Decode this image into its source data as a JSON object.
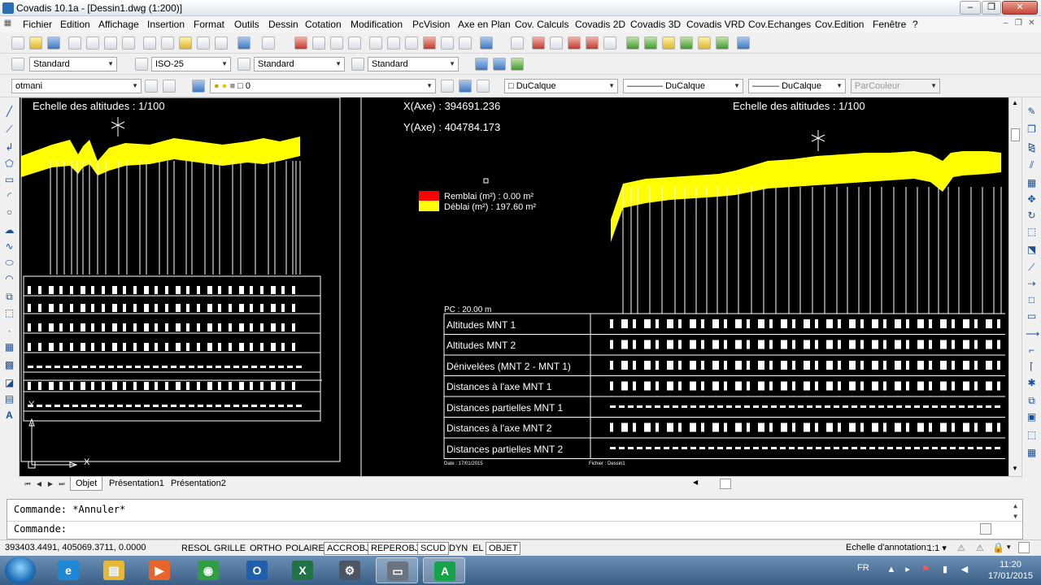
{
  "window": {
    "title": "Covadis 10.1a - [Dessin1.dwg (1:200)]",
    "minimize": "‒",
    "restore": "❐",
    "close": "✕"
  },
  "menu": {
    "items": [
      "Fichier",
      "Edition",
      "Affichage",
      "Insertion",
      "Format",
      "Outils",
      "Dessin",
      "Cotation",
      "Modification",
      "PcVision",
      "Axe en Plan",
      "Cov. Calculs",
      "Covadis 2D",
      "Covadis 3D",
      "Covadis VRD",
      "Cov.Echanges",
      "Cov.Edition",
      "Fenêtre",
      "?"
    ]
  },
  "toolbar_styles": {
    "text_style": "Standard",
    "dim_style": "ISO-25",
    "table_style": "Standard",
    "multileader_style": "Standard"
  },
  "toolbar_layers": {
    "current_layer": "otmani",
    "layer_state": "0",
    "color": "DuCalque",
    "linetype": "DuCalque",
    "lineweight": "DuCalque",
    "plot_style": "ParCouleur"
  },
  "drawing": {
    "left_scale_label": "Echelle des altitudes : 1/100",
    "right_scale_label": "Echelle des altitudes : 1/100",
    "x_axe": "X(Axe) : 394691.236",
    "y_axe": "Y(Axe) : 404784.173",
    "legend": {
      "remblai": "Remblai (m²) : 0.00 m²",
      "deblai": "Déblai (m²) : 197.60 m²",
      "remblai_color": "#ff0000",
      "deblai_color": "#ffff00"
    },
    "pc_label": "PC : 20.00 m",
    "rows": [
      "Altitudes MNT 1",
      "Altitudes MNT 2",
      "Dénivelées (MNT 2 - MNT 1)",
      "Distances à l'axe MNT 1",
      "Distances partielles MNT 1",
      "Distances à l'axe MNT 2",
      "Distances partielles MNT 2"
    ],
    "footer_date": "Date : 17/01/2015",
    "footer_file": "Fichier : Dessin1",
    "ucs_x": "X",
    "ucs_y": "Y",
    "profile_color": "#ffff00"
  },
  "tabs": {
    "items": [
      "Objet",
      "Présentation1",
      "Présentation2"
    ],
    "active": "Objet"
  },
  "command": {
    "history": "Commande: *Annuler*",
    "prompt": "Commande:"
  },
  "status": {
    "coordinates": "393403.4491, 405069.3711, 0.0000",
    "toggles": [
      {
        "label": "RESOL",
        "on": false
      },
      {
        "label": "GRILLE",
        "on": false
      },
      {
        "label": "ORTHO",
        "on": false
      },
      {
        "label": "POLAIRE",
        "on": false
      },
      {
        "label": "ACCROBJ",
        "on": true
      },
      {
        "label": "REPEROBJ",
        "on": true
      },
      {
        "label": "SCUD",
        "on": true
      },
      {
        "label": "DYN",
        "on": false
      },
      {
        "label": "EL",
        "on": false
      },
      {
        "label": "OBJET",
        "on": true
      }
    ],
    "annotation_scale_label": "Echelle d'annotation:",
    "annotation_scale_value": "1:1"
  },
  "taskbar": {
    "apps": [
      {
        "name": "internet-explorer",
        "glyph": "e",
        "color": "#1e88d6"
      },
      {
        "name": "file-explorer",
        "glyph": "▤",
        "color": "#e7b93a"
      },
      {
        "name": "media-player",
        "glyph": "▶",
        "color": "#e8642a"
      },
      {
        "name": "chrome",
        "glyph": "◉",
        "color": "#2f9e44"
      },
      {
        "name": "outlook",
        "glyph": "O",
        "color": "#1f5fae"
      },
      {
        "name": "excel",
        "glyph": "X",
        "color": "#217346"
      },
      {
        "name": "autocad-tool",
        "glyph": "⚙",
        "color": "#4b5563"
      },
      {
        "name": "remote-desktop",
        "glyph": "▭",
        "color": "#6b7280"
      },
      {
        "name": "covadis",
        "glyph": "A",
        "color": "#16a34a"
      }
    ],
    "language": "FR",
    "time": "11:20",
    "date": "17/01/2015"
  }
}
